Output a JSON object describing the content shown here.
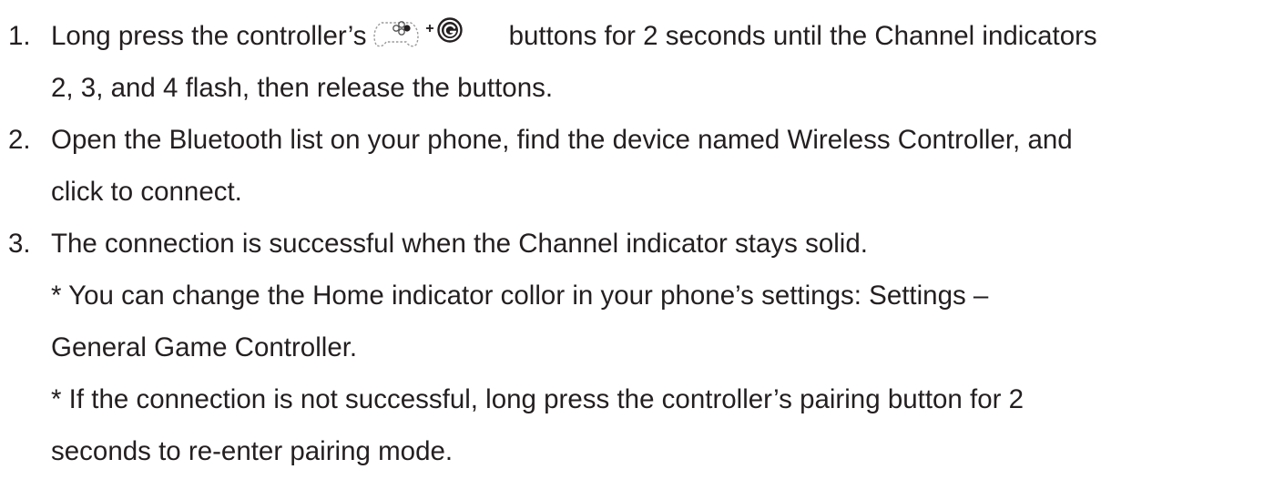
{
  "instructions": {
    "steps": [
      {
        "number": "1.",
        "lines": [
          "Long press the controller’s",
          "buttons for 2 seconds until the Channel indicators",
          "2, 3, and 4 flash, then release the buttons."
        ],
        "icons": [
          "gamepad-pairing-icon",
          "home-button-icon"
        ],
        "icon_joiner": "+"
      },
      {
        "number": "2.",
        "lines": [
          "Open the Bluetooth list on your phone, find the device named Wireless Controller, and",
          "click to connect."
        ]
      },
      {
        "number": "3.",
        "lines": [
          "The connection is successful when the Channel indicator stays solid."
        ]
      }
    ],
    "notes": [
      {
        "lines": [
          "* You can change the Home indicator collor in your phone’s settings: Settings –",
          "General Game Controller."
        ]
      },
      {
        "lines": [
          "* If the connection is not successful, long press the controller’s pairing button for 2",
          "seconds to re-enter pairing mode."
        ]
      }
    ]
  }
}
